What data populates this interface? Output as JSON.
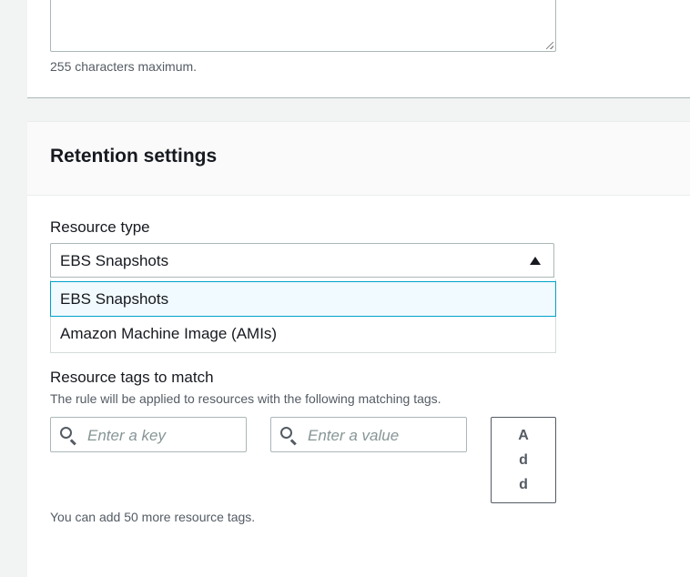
{
  "description": {
    "hint": "255 characters maximum."
  },
  "retention": {
    "title": "Retention settings",
    "resource_type": {
      "label": "Resource type",
      "selected": "EBS Snapshots",
      "options": [
        "EBS Snapshots",
        "Amazon Machine Image (AMIs)"
      ]
    },
    "tags": {
      "label": "Resource tags to match",
      "description": "The rule will be applied to resources with the following matching tags.",
      "key_placeholder": "Enter a key",
      "value_placeholder": "Enter a value",
      "add_label": "Add",
      "limit_text": "You can add 50 more resource tags."
    }
  },
  "icons": {
    "search": "search-icon",
    "caret": "caret-up-icon"
  }
}
